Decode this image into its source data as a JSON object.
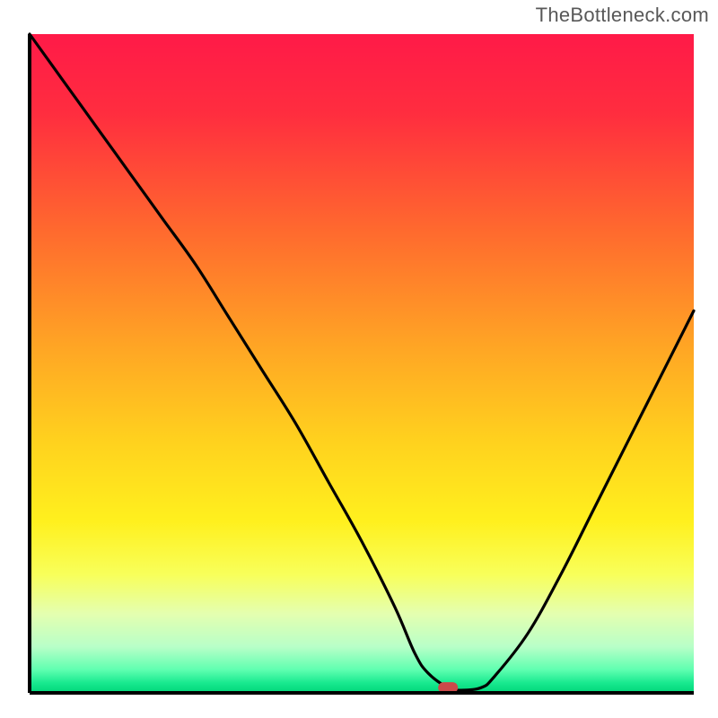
{
  "watermark": "TheBottleneck.com",
  "chart_data": {
    "type": "line",
    "title": "",
    "xlabel": "",
    "ylabel": "",
    "xlim": [
      0,
      100
    ],
    "ylim": [
      0,
      100
    ],
    "x": [
      0,
      5,
      10,
      15,
      20,
      25,
      30,
      35,
      40,
      45,
      50,
      55,
      58,
      60,
      63,
      65,
      68,
      70,
      75,
      80,
      85,
      90,
      95,
      100
    ],
    "values": [
      100,
      93,
      86,
      79,
      72,
      65,
      57,
      49,
      41,
      32,
      23,
      13,
      6,
      3,
      0.8,
      0.4,
      0.8,
      2.5,
      9,
      18,
      28,
      38,
      48,
      58
    ],
    "marker": {
      "x": 63,
      "y": 0.8
    },
    "gradient_stops": [
      {
        "offset": 0.0,
        "color": "#ff1a48"
      },
      {
        "offset": 0.12,
        "color": "#ff2d3f"
      },
      {
        "offset": 0.3,
        "color": "#ff6a2e"
      },
      {
        "offset": 0.48,
        "color": "#ffa724"
      },
      {
        "offset": 0.62,
        "color": "#ffd21e"
      },
      {
        "offset": 0.74,
        "color": "#fff01e"
      },
      {
        "offset": 0.82,
        "color": "#f8ff5a"
      },
      {
        "offset": 0.88,
        "color": "#e4ffb0"
      },
      {
        "offset": 0.93,
        "color": "#b8ffc8"
      },
      {
        "offset": 0.965,
        "color": "#5fffb0"
      },
      {
        "offset": 0.985,
        "color": "#18e98f"
      },
      {
        "offset": 1.0,
        "color": "#00d67a"
      }
    ],
    "axis_color": "#000000",
    "line_color": "#000000",
    "marker_color": "#cc4a4a"
  }
}
